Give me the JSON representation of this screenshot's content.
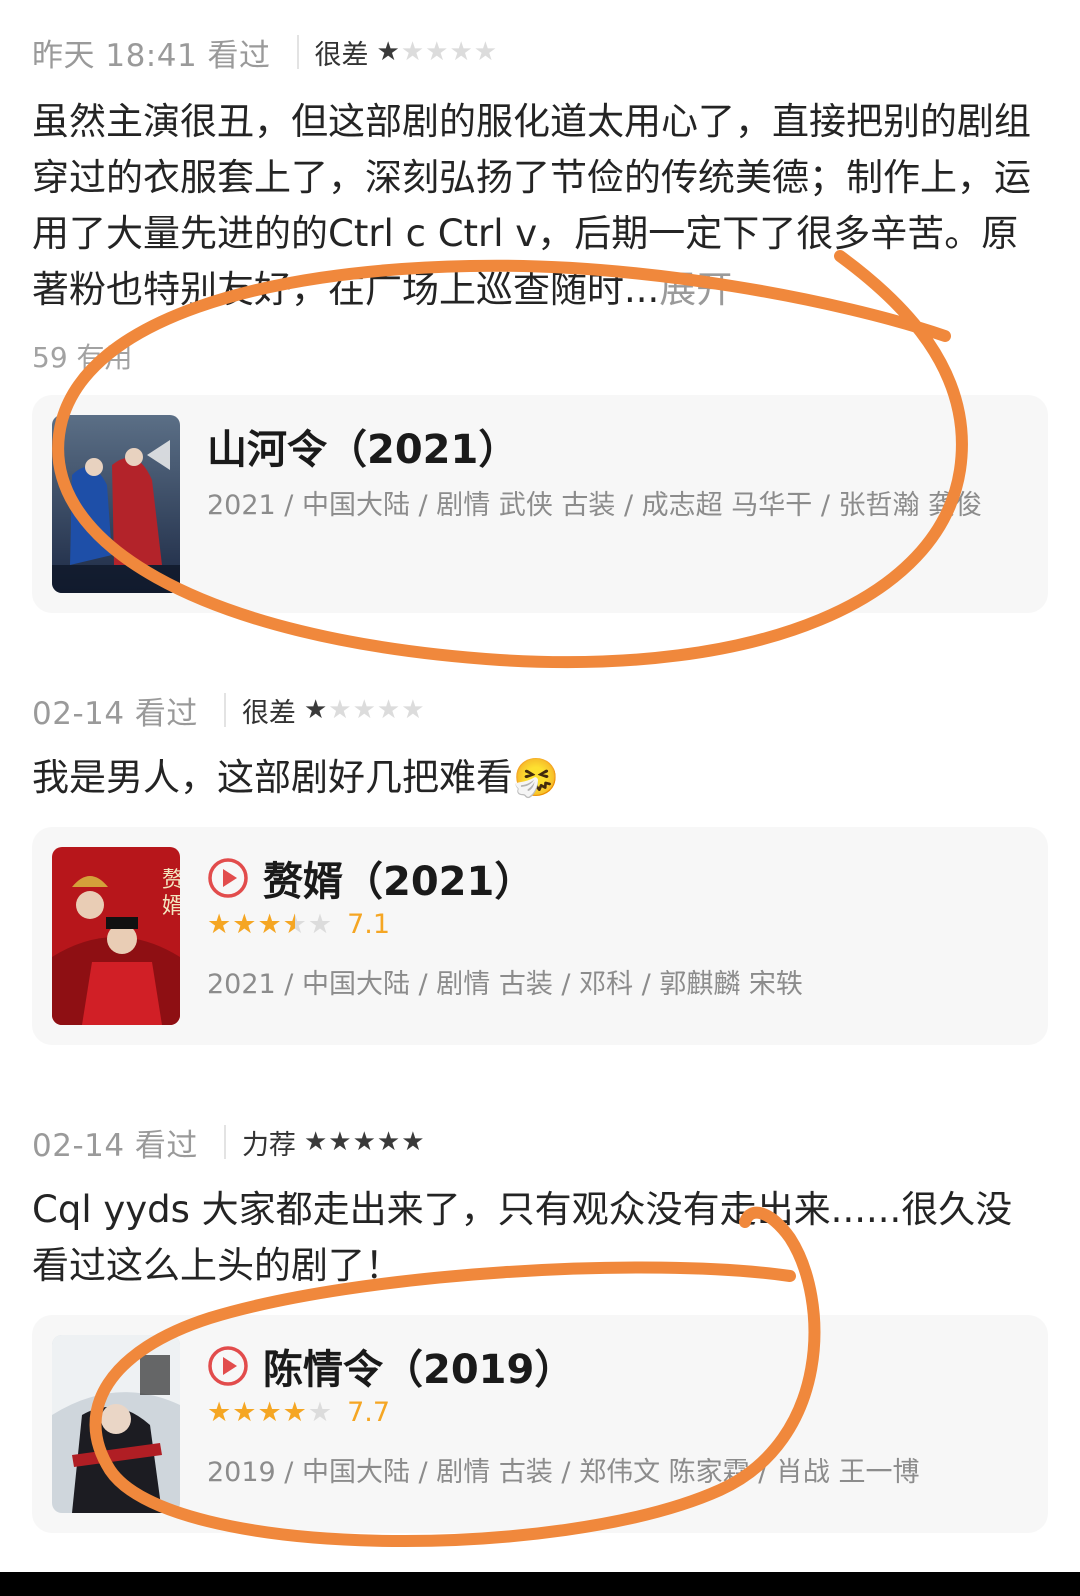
{
  "reviews": [
    {
      "when": "昨天 18:41 看过",
      "rating_word": "很差",
      "stars_filled": 1,
      "text": "虽然主演很丑，但这部剧的服化道太用心了，直接把别的剧组穿过的衣服套上了，深刻弘扬了节俭的传统美德；制作上，运用了大量先进的的Ctrl c Ctrl v，后期一定下了很多辛苦。原著粉也特别友好，在广场上巡查随时...",
      "expand_label": "展开",
      "useful": "59 有用",
      "card": {
        "title": "山河令（2021）",
        "has_play": false,
        "meta": "2021 / 中国大陆 / 剧情 武侠 古装 / 成志超 马华干 / 张哲瀚 龚俊"
      }
    },
    {
      "when": "02-14 看过",
      "rating_word": "很差",
      "stars_filled": 1,
      "text": "我是男人，这部剧好几把难看🤧",
      "card": {
        "title": "赘婿（2021）",
        "has_play": true,
        "score": "7.1",
        "score_stars": 3.5,
        "meta": "2021 / 中国大陆 / 剧情 古装 / 邓科 / 郭麒麟 宋轶"
      }
    },
    {
      "when": "02-14 看过",
      "rating_word": "力荐",
      "stars_filled": 5,
      "text": "Cql yyds  大家都走出来了，只有观众没有走出来......很久没看过这么上头的剧了！",
      "card": {
        "title": "陈情令（2019）",
        "has_play": true,
        "score": "7.7",
        "score_stars": 4,
        "meta": "2019 / 中国大陆 / 剧情 古装 / 郑伟文 陈家霖 / 肖战 王一博"
      }
    }
  ],
  "colors": {
    "score": "#f5a623",
    "annotation": "#f0883c",
    "card_bg": "#f7f7f7"
  },
  "icons": [
    "star-icon",
    "play-icon"
  ]
}
